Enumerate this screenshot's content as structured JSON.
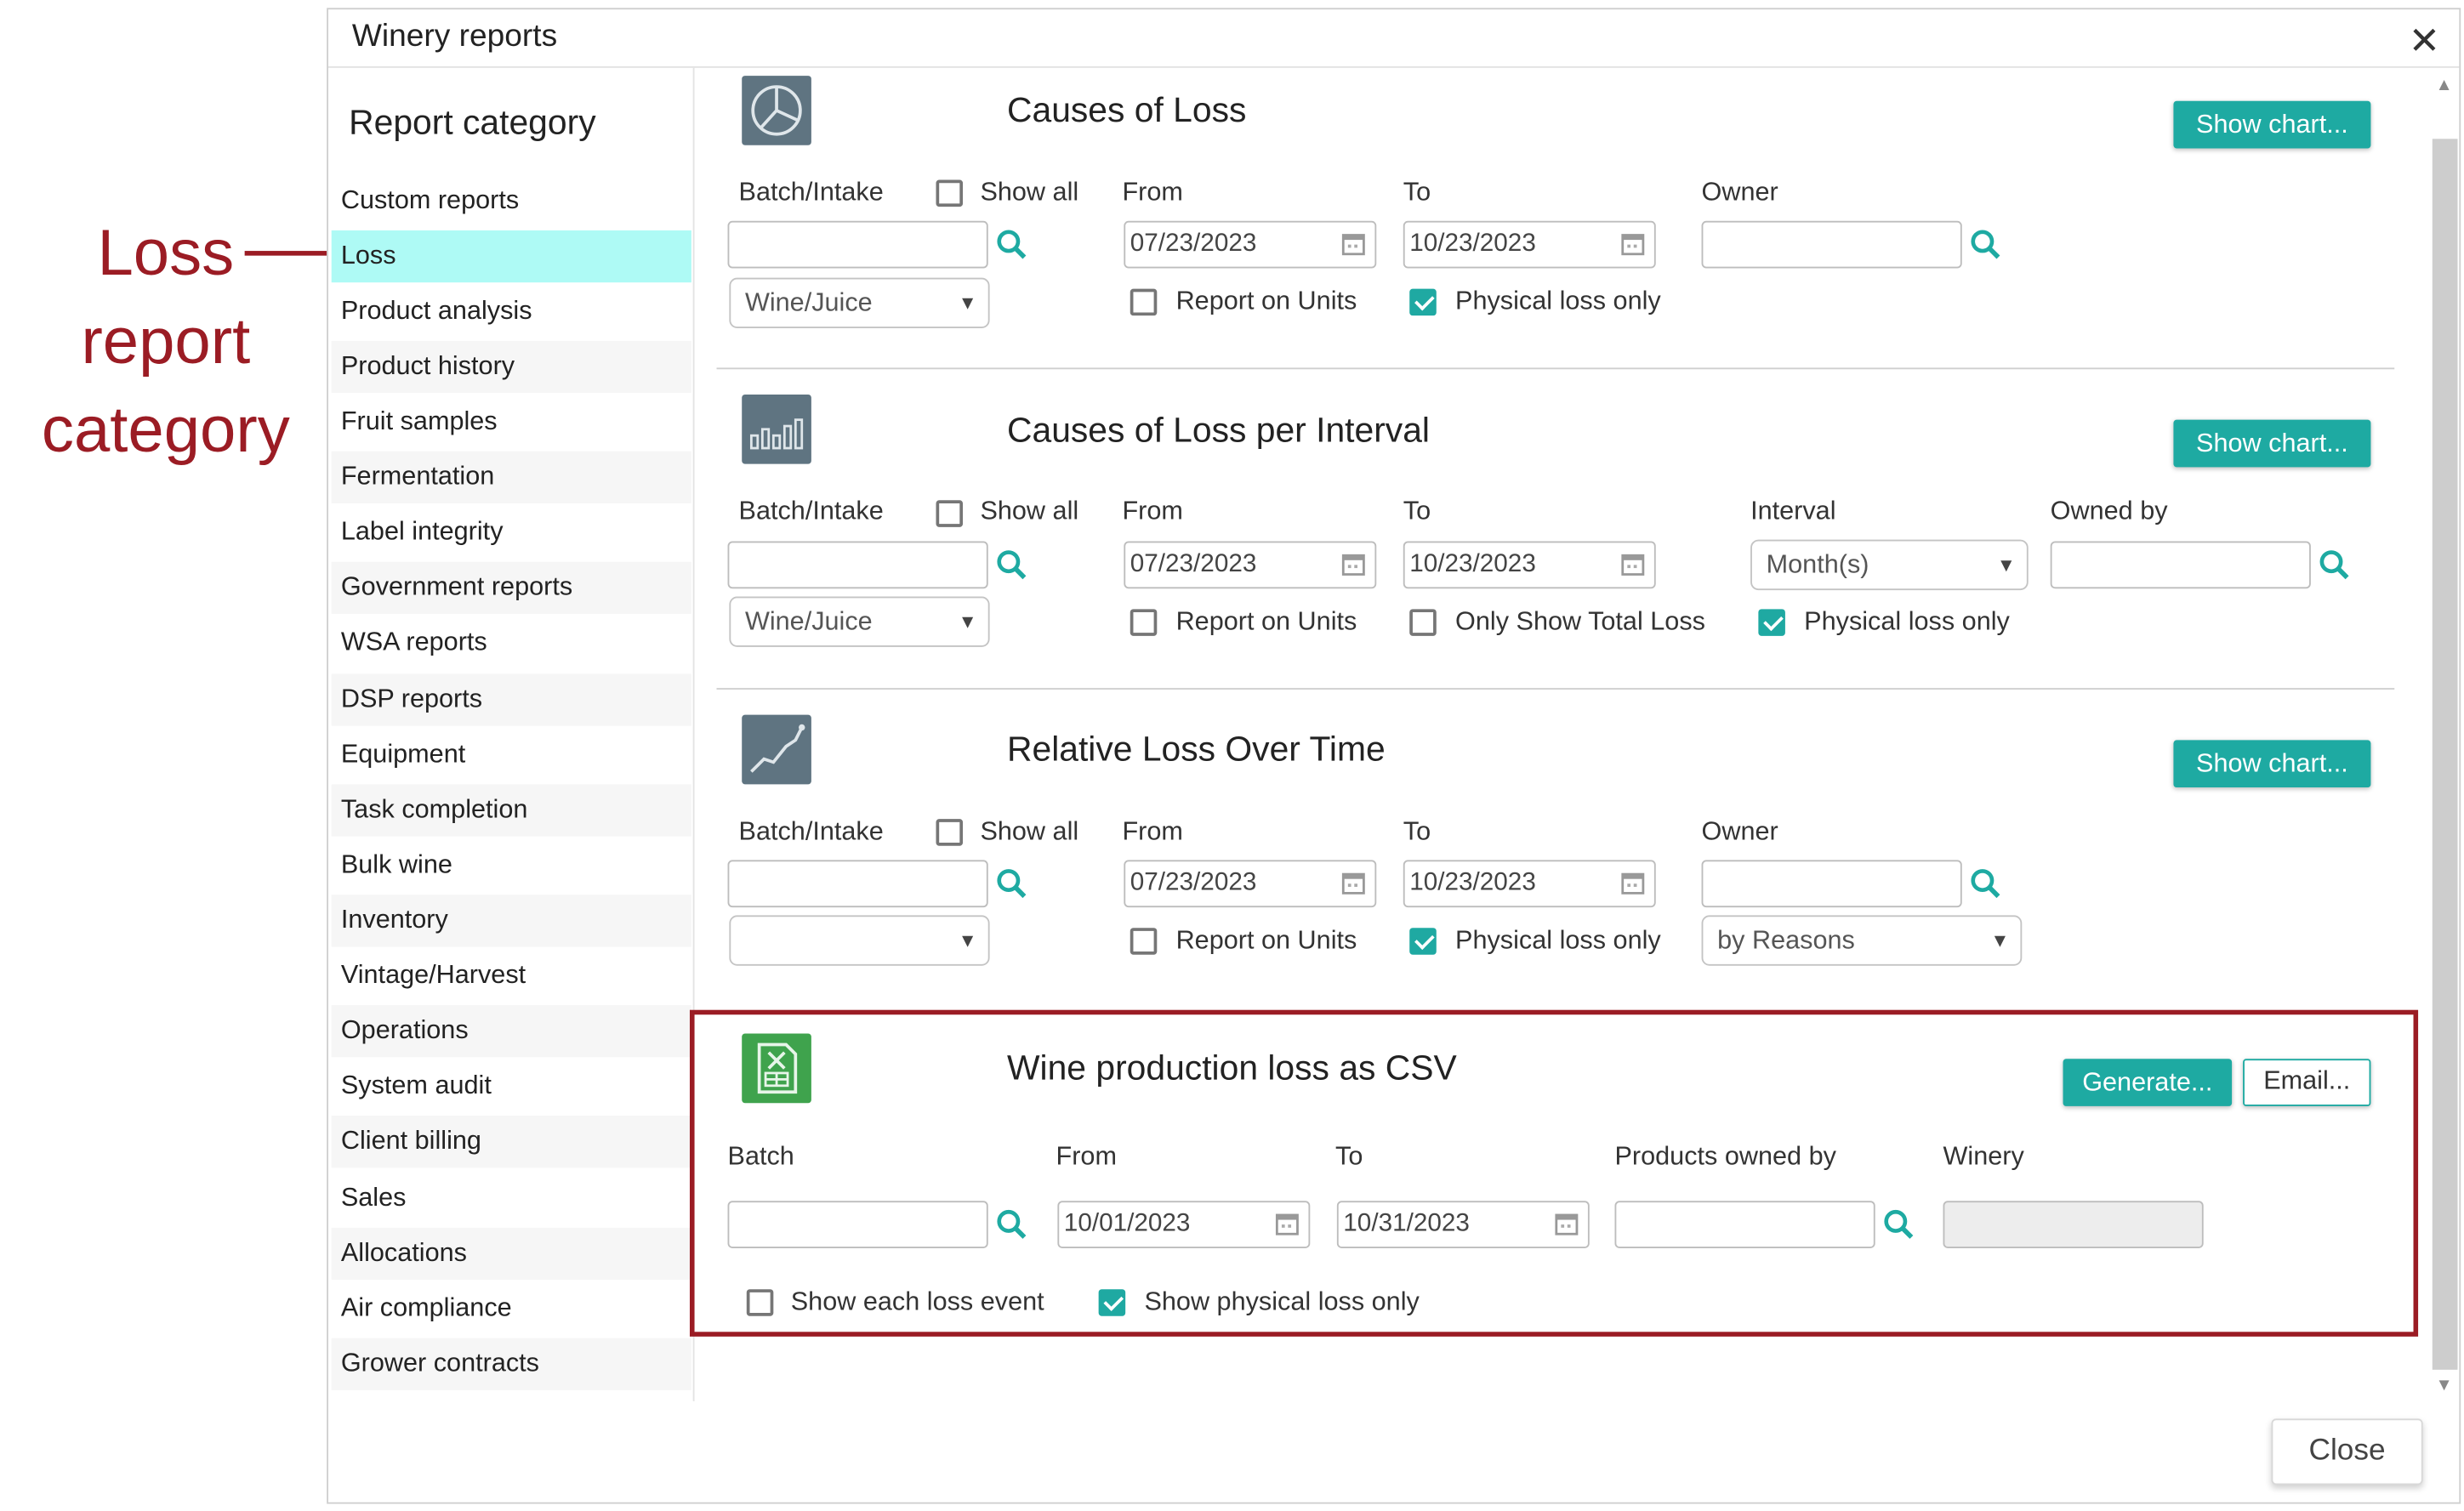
{
  "annotation": {
    "lines": [
      "Loss",
      "report",
      "category"
    ]
  },
  "window": {
    "title": "Winery reports",
    "close_button": "Close"
  },
  "sidebar": {
    "heading": "Report category",
    "items": [
      {
        "label": "Custom reports"
      },
      {
        "label": "Loss"
      },
      {
        "label": "Product analysis"
      },
      {
        "label": "Product history"
      },
      {
        "label": "Fruit samples"
      },
      {
        "label": "Fermentation"
      },
      {
        "label": "Label integrity"
      },
      {
        "label": "Government reports"
      },
      {
        "label": "WSA reports"
      },
      {
        "label": "DSP reports"
      },
      {
        "label": "Equipment"
      },
      {
        "label": "Task completion"
      },
      {
        "label": "Bulk wine"
      },
      {
        "label": "Inventory"
      },
      {
        "label": "Vintage/Harvest"
      },
      {
        "label": "Operations"
      },
      {
        "label": "System audit"
      },
      {
        "label": "Client billing"
      },
      {
        "label": "Sales"
      },
      {
        "label": "Allocations"
      },
      {
        "label": "Air compliance"
      },
      {
        "label": "Grower contracts"
      }
    ],
    "selected": "Loss"
  },
  "reports": {
    "causes": {
      "title": "Causes of Loss",
      "show_chart": "Show chart...",
      "batch_label": "Batch/Intake",
      "show_all": "Show all",
      "from_label": "From",
      "from_value": "07/23/2023",
      "to_label": "To",
      "to_value": "10/23/2023",
      "owner_label": "Owner",
      "type_select": "Wine/Juice",
      "report_units": "Report on Units",
      "physical_only": "Physical loss only"
    },
    "interval": {
      "title": "Causes of Loss per Interval",
      "show_chart": "Show chart...",
      "batch_label": "Batch/Intake",
      "show_all": "Show all",
      "from_label": "From",
      "from_value": "07/23/2023",
      "to_label": "To",
      "to_value": "10/23/2023",
      "interval_label": "Interval",
      "interval_value": "Month(s)",
      "owned_by_label": "Owned by",
      "type_select": "Wine/Juice",
      "report_units": "Report on Units",
      "only_total": "Only Show Total Loss",
      "physical_only": "Physical loss only"
    },
    "relative": {
      "title": "Relative Loss Over Time",
      "show_chart": "Show chart...",
      "batch_label": "Batch/Intake",
      "show_all": "Show all",
      "from_label": "From",
      "from_value": "07/23/2023",
      "to_label": "To",
      "to_value": "10/23/2023",
      "owner_label": "Owner",
      "report_units": "Report on Units",
      "physical_only": "Physical loss only",
      "group_select": "by Reasons"
    },
    "csv": {
      "title": "Wine production loss as CSV",
      "generate": "Generate...",
      "email": "Email...",
      "batch_label": "Batch",
      "from_label": "From",
      "from_value": "10/01/2023",
      "to_label": "To",
      "to_value": "10/31/2023",
      "owned_label": "Products owned by",
      "winery_label": "Winery",
      "show_each": "Show each loss event",
      "show_physical": "Show physical loss only"
    }
  },
  "colors": {
    "accent": "#1eaaa2",
    "annotation": "#9b1c24",
    "selected_bg": "#aefaf5"
  }
}
